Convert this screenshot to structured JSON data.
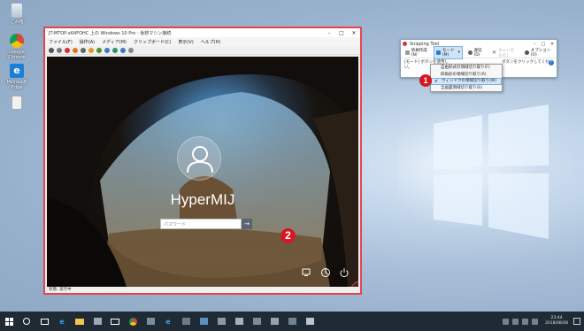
{
  "desktop": {
    "icons": [
      {
        "label": "ごみ箱",
        "icon": "recycle-bin-icon"
      },
      {
        "label": "Google Chrome",
        "icon": "chrome-icon"
      },
      {
        "label": "Microsoft Edge",
        "icon": "edge-icon"
      },
      {
        "label": "",
        "icon": "document-icon"
      }
    ]
  },
  "vm_window": {
    "title": "JT-MTOP-x64FOHC 上の Windows 10 Pro - 仮想マシン接続",
    "menu": [
      "ファイル(F)",
      "操作(A)",
      "メディア(M)",
      "クリップボード(C)",
      "表示(V)",
      "ヘルプ(H)"
    ],
    "status": "状態: 実行中",
    "login": {
      "username": "HyperMIJ",
      "password_placeholder": "パスワード"
    }
  },
  "snipping_tool": {
    "title": "Snipping Tool",
    "toolbar": {
      "new": "新規作成(N)",
      "mode": "モード(M)",
      "delay": "遅延(D)",
      "cancel": "キャンセル(C)",
      "options": "オプション(O)"
    },
    "hint_line1": "[モード] ボタンを使用し",
    "hint_line2": "ボタンをクリックしてくださ",
    "hint_line3": "い。",
    "mode_menu": [
      {
        "label": "自由形式の領域切り取り(F)",
        "checked": false,
        "selected": false
      },
      {
        "label": "四角形の領域切り取り(R)",
        "checked": false,
        "selected": false
      },
      {
        "label": "ウィンドウの領域切り取り(W)",
        "checked": true,
        "selected": true
      },
      {
        "label": "全画面領域切り取り(S)",
        "checked": false,
        "selected": false
      }
    ]
  },
  "annotations": {
    "badge1": "1",
    "badge2": "2"
  },
  "taskbar": {
    "time": "23:44",
    "date": "2018/08/08"
  },
  "colors": {
    "accent": "#e8434c",
    "badge": "#d41822",
    "taskbar": "#202a35"
  }
}
